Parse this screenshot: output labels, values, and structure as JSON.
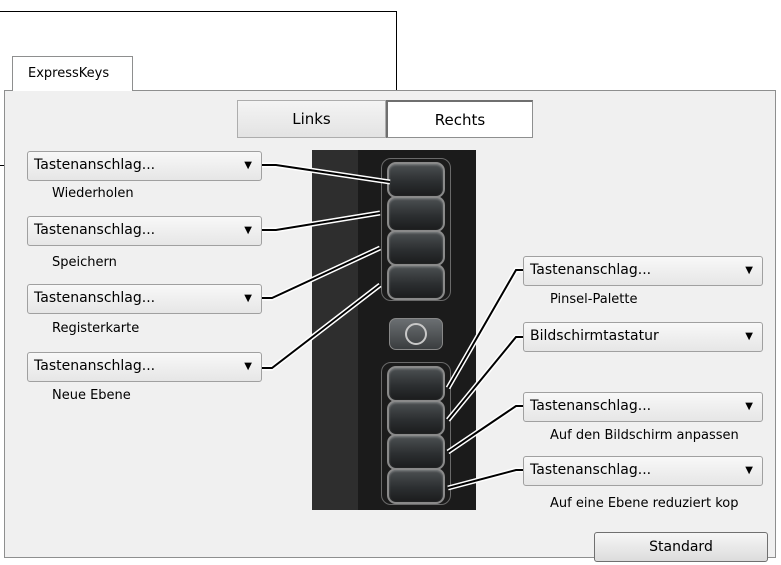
{
  "tabs": {
    "active_tab": "ExpressKeys"
  },
  "side_toggle": {
    "left": "Links",
    "right": "Rechts",
    "selected": "Rechts"
  },
  "left_keys": [
    {
      "dropdown": "Tastenanschlag...",
      "label": "Wiederholen"
    },
    {
      "dropdown": "Tastenanschlag...",
      "label": "Speichern"
    },
    {
      "dropdown": "Tastenanschlag...",
      "label": "Registerkarte"
    },
    {
      "dropdown": "Tastenanschlag...",
      "label": "Neue Ebene"
    }
  ],
  "right_keys": [
    {
      "dropdown": "Tastenanschlag...",
      "label": "Pinsel-Palette"
    },
    {
      "dropdown": "Bildschirmtastatur",
      "label": ""
    },
    {
      "dropdown": "Tastenanschlag...",
      "label": "Auf den Bildschirm anpassen"
    },
    {
      "dropdown": "Tastenanschlag...",
      "label": "Auf eine Ebene reduziert kop"
    }
  ],
  "dropdown_arrow_glyph": "▼",
  "buttons": {
    "default": "Standard"
  },
  "colors": {
    "panel": "#f0f0f0",
    "tablet": "#1b1b1b",
    "key_border": "#8a8a8a"
  }
}
